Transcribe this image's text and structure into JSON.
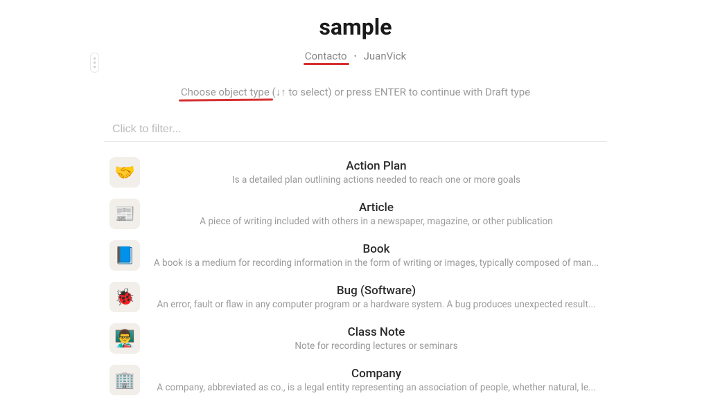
{
  "title": "sample",
  "breadcrumb": {
    "contact": "Contacto",
    "separator": "•",
    "user": "JuanVick"
  },
  "hint": {
    "prefix": "Choose object type",
    "rest": " (↓↑ to select) or press ENTER to continue with Draft type"
  },
  "filter": {
    "placeholder": "Click to filter...",
    "value": ""
  },
  "items": [
    {
      "icon": "🤝",
      "title": "Action Plan",
      "desc": "Is a detailed plan outlining actions needed to reach one or more goals"
    },
    {
      "icon": "📰",
      "title": "Article",
      "desc": "A piece of writing included with others in a newspaper, magazine, or other publication"
    },
    {
      "icon": "📘",
      "title": "Book",
      "desc": "A book is a medium for recording information in the form of writing or images, typically composed of man..."
    },
    {
      "icon": "🐞",
      "title": "Bug (Software)",
      "desc": "An error, fault or flaw in any computer program or a hardware system. A bug produces unexpected result..."
    },
    {
      "icon": "👨‍🏫",
      "title": "Class Note",
      "desc": "Note for recording lectures or seminars"
    },
    {
      "icon": "🏢",
      "title": "Company",
      "desc": "A company, abbreviated as co., is a legal entity representing an association of people, whether natural, le..."
    }
  ]
}
